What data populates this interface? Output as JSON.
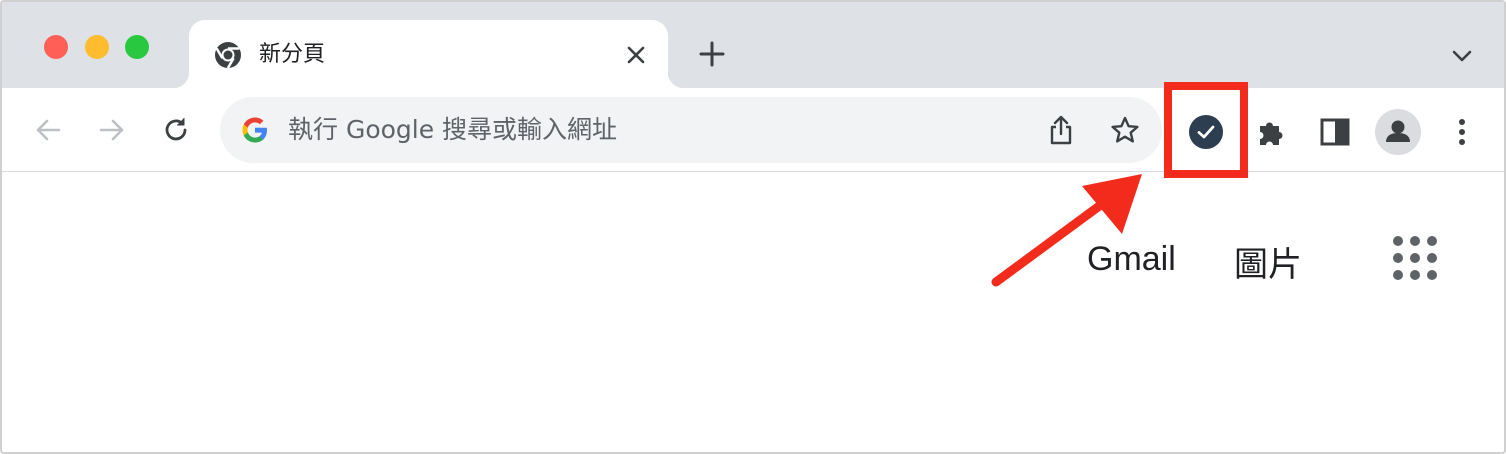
{
  "tab": {
    "title": "新分頁",
    "favicon": "chrome-icon"
  },
  "toolbar": {
    "omnibox_placeholder": "執行 Google 搜尋或輸入網址",
    "icons": [
      "back-arrow-icon",
      "forward-arrow-icon",
      "reload-icon",
      "google-g-icon",
      "share-icon",
      "star-icon",
      "extension-check-icon",
      "puzzle-icon",
      "side-panel-icon",
      "profile-icon",
      "kebab-menu-icon"
    ]
  },
  "content": {
    "gmail_link": "Gmail",
    "images_link": "圖片"
  },
  "colors": {
    "tabstrip_bg": "#dee1e6",
    "omnibox_bg": "#f1f3f4",
    "highlight": "#f32b1c",
    "extension_icon": "#2c3e50"
  }
}
